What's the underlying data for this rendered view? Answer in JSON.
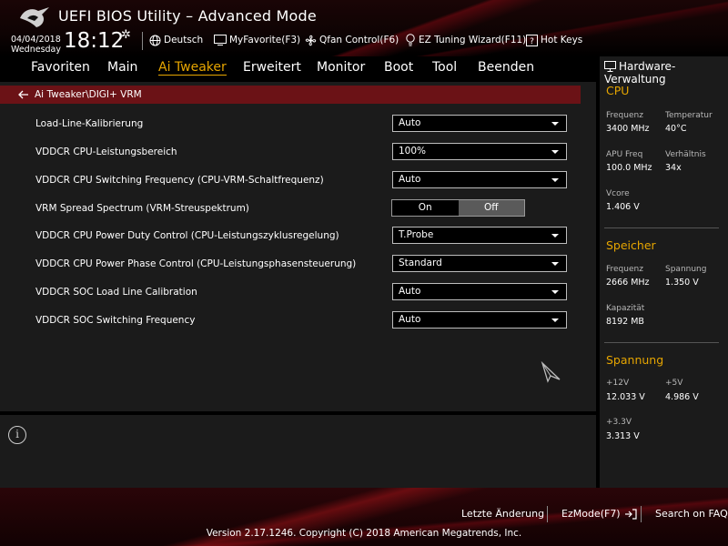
{
  "header": {
    "title": "UEFI BIOS Utility – Advanced Mode",
    "date": "04/04/2018",
    "weekday": "Wednesday",
    "time": "18:12",
    "language": "Deutsch",
    "myfavorite": "MyFavorite(F3)",
    "qfan": "Qfan Control(F6)",
    "ez_tuning": "EZ Tuning Wizard(F11)",
    "hotkeys": "Hot Keys"
  },
  "menu": {
    "items": [
      "Favoriten",
      "Main",
      "Ai Tweaker",
      "Erweitert",
      "Monitor",
      "Boot",
      "Tool",
      "Beenden"
    ],
    "active": "Ai Tweaker"
  },
  "breadcrumb": "Ai Tweaker\\DIGI+ VRM",
  "settings": [
    {
      "label": "Load-Line-Kalibrierung",
      "value": "Auto"
    },
    {
      "label": "VDDCR CPU-Leistungsbereich",
      "value": "100%"
    },
    {
      "label": "VDDCR CPU Switching Frequency (CPU-VRM-Schaltfrequenz)",
      "value": "Auto"
    },
    {
      "label": "VRM Spread Spectrum (VRM-Streuspektrum)",
      "on": "On",
      "off": "Off",
      "selected": "Off"
    },
    {
      "label": "VDDCR CPU Power Duty Control (CPU-Leistungszyklusregelung)",
      "value": "T.Probe"
    },
    {
      "label": "VDDCR CPU Power Phase Control (CPU-Leistungsphasensteuerung)",
      "value": "Standard"
    },
    {
      "label": "VDDCR SOC Load Line Calibration",
      "value": "Auto"
    },
    {
      "label": "VDDCR SOC Switching Frequency",
      "value": "Auto"
    }
  ],
  "hw": {
    "title": "Hardware-Verwaltung",
    "cpu": {
      "heading": "CPU",
      "freq_label": "Frequenz",
      "freq": "3400 MHz",
      "temp_label": "Temperatur",
      "temp": "40°C",
      "apu_label": "APU Freq",
      "apu": "100.0 MHz",
      "ratio_label": "Verhältnis",
      "ratio": "34x",
      "vcore_label": "Vcore",
      "vcore": "1.406 V"
    },
    "memory": {
      "heading": "Speicher",
      "freq_label": "Frequenz",
      "freq": "2666 MHz",
      "volt_label": "Spannung",
      "volt": "1.350 V",
      "cap_label": "Kapazität",
      "cap": "8192 MB"
    },
    "voltage": {
      "heading": "Spannung",
      "v12_label": "+12V",
      "v12": "12.033 V",
      "v5_label": "+5V",
      "v5": "4.986 V",
      "v33_label": "+3.3V",
      "v33": "3.313 V"
    }
  },
  "footer": {
    "last_change": "Letzte Änderung",
    "ezmode": "EzMode(F7)",
    "search": "Search on FAQ",
    "copyright": "Version 2.17.1246. Copyright (C) 2018 American Megatrends, Inc."
  },
  "colors": {
    "accent": "#e6a500",
    "breadcrumb_bg": "#6b1216",
    "panel_bg": "#1b1b1b"
  }
}
